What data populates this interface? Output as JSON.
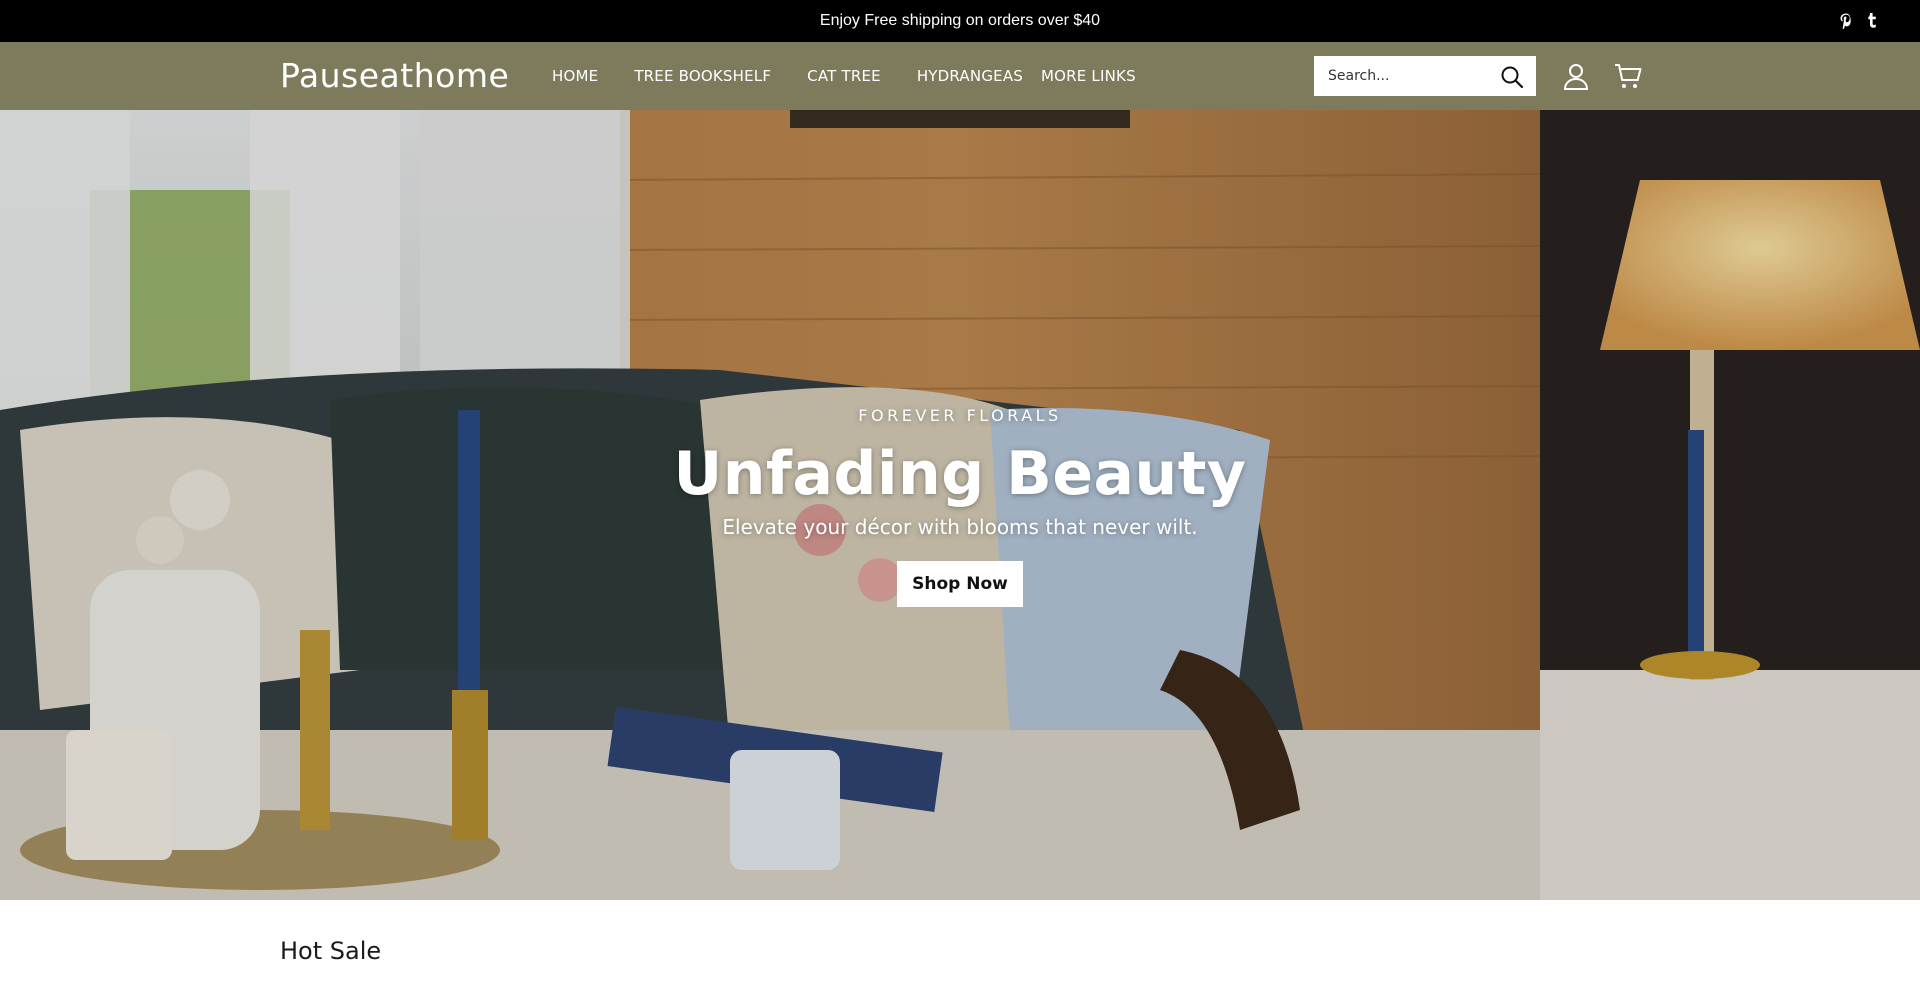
{
  "announcement": {
    "text": "Enjoy Free shipping on orders over $40",
    "social": [
      "pinterest-icon",
      "tumblr-icon"
    ]
  },
  "header": {
    "logo": "Pauseathome",
    "nav": [
      "HOME",
      "TREE BOOKSHELF",
      "CAT TREE",
      "HYDRANGEAS",
      "MORE LINKS"
    ],
    "search_placeholder": "Search...",
    "icons": [
      "search-icon",
      "user-icon",
      "cart-icon"
    ],
    "background": "#7e7b5c"
  },
  "hero": {
    "eyebrow": "FOREVER FLORALS",
    "title": "Unfading Beauty",
    "subtitle": "Elevate your décor with blooms that never wilt.",
    "button": "Shop Now"
  },
  "sections": {
    "hot_sale": "Hot Sale"
  }
}
